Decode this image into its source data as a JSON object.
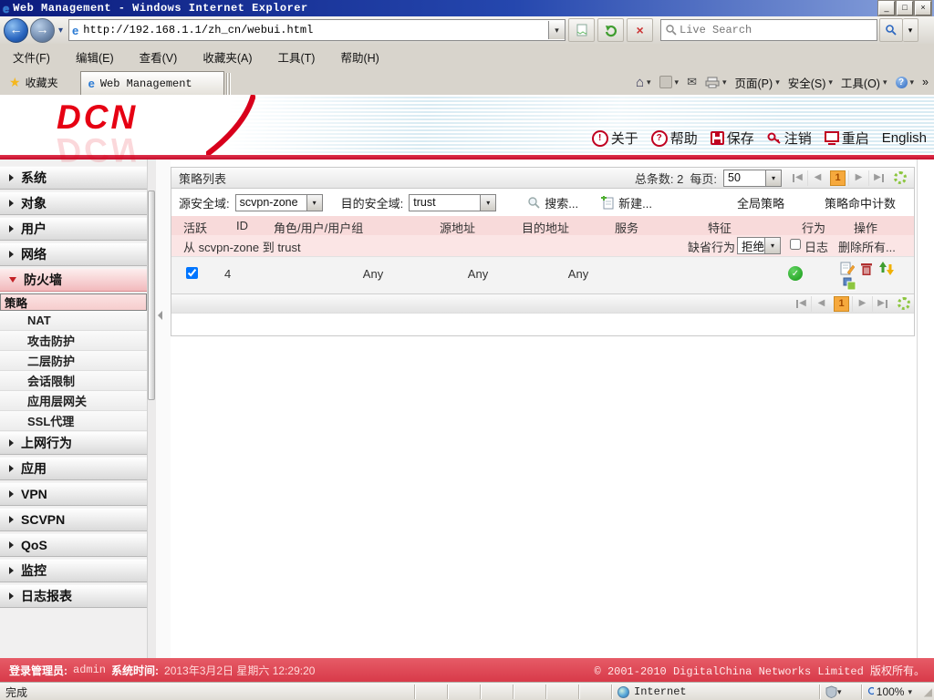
{
  "icons": {
    "ie_logo": "e",
    "minimize": "_",
    "maximize": "□",
    "close": "×",
    "back": "←",
    "forward": "→",
    "caret": "▾",
    "stop": "×",
    "star": "★",
    "home": "⌂",
    "mail": "✉",
    "help_q": "?",
    "overflow": "»",
    "about": "!",
    "check": "✓",
    "pg_prev": "◀",
    "pg_next": "▶",
    "resize_grip": "◢"
  },
  "browser": {
    "window_title": "Web Management - Windows Internet Explorer",
    "url": "http://192.168.1.1/zh_cn/webui.html",
    "search_placeholder": "Live Search",
    "menu_items": [
      "文件(F)",
      "编辑(E)",
      "查看(V)",
      "收藏夹(A)",
      "工具(T)",
      "帮助(H)"
    ],
    "favorites_label": "收藏夹",
    "tab_title": "Web Management",
    "page_label": "页面(P)",
    "security_label": "安全(S)",
    "tools_label": "工具(O)",
    "status_done": "完成",
    "status_zone": "Internet",
    "status_zoom": "100%"
  },
  "header": {
    "logo_text": "DCN",
    "about_label": "关于",
    "help_label": "帮助",
    "save_label": "保存",
    "logout_label": "注销",
    "restart_label": "重启",
    "lang_label": "English"
  },
  "sidebar": {
    "items": [
      {
        "label": "系统"
      },
      {
        "label": "对象"
      },
      {
        "label": "用户"
      },
      {
        "label": "网络"
      },
      {
        "label": "防火墙"
      },
      {
        "label": "上网行为"
      },
      {
        "label": "应用"
      },
      {
        "label": "VPN"
      },
      {
        "label": "SCVPN"
      },
      {
        "label": "QoS"
      },
      {
        "label": "监控"
      },
      {
        "label": "日志报表"
      }
    ],
    "firewall_children": [
      {
        "label": "策略"
      },
      {
        "label": "NAT"
      },
      {
        "label": "攻击防护"
      },
      {
        "label": "二层防护"
      },
      {
        "label": "会话限制"
      },
      {
        "label": "应用层网关"
      },
      {
        "label": "SSL代理"
      }
    ]
  },
  "content": {
    "panel_title": "策略列表",
    "total_label": "总条数: 2",
    "per_page_label": "每页:",
    "per_page_value": "50",
    "page_number": "1",
    "src_zone_label": "源安全域:",
    "src_zone_value": "scvpn-zone",
    "dst_zone_label": "目的安全域:",
    "dst_zone_value": "trust",
    "search_label": "搜索...",
    "new_label": "新建...",
    "global_policy_label": "全局策略",
    "hit_count_label": "策略命中计数",
    "table_headers": [
      "活跃",
      "ID",
      "角色/用户/用户组",
      "源地址",
      "目的地址",
      "服务",
      "特征",
      "行为",
      "操作"
    ],
    "group_label": "从 scvpn-zone 到 trust",
    "default_action_label": "缺省行为",
    "default_action_value": "拒绝",
    "log_label": "日志",
    "delete_all_label": "删除所有...",
    "row": {
      "id": "4",
      "src": "Any",
      "dst": "Any",
      "service": "Any"
    }
  },
  "footer": {
    "admin_label": "登录管理员:",
    "admin_value": "admin",
    "time_label": "系统时间:",
    "time_value": "2013年3月2日 星期六 12:29:20",
    "copyright": "© 2001-2010 DigitalChina Networks Limited 版权所有。"
  }
}
